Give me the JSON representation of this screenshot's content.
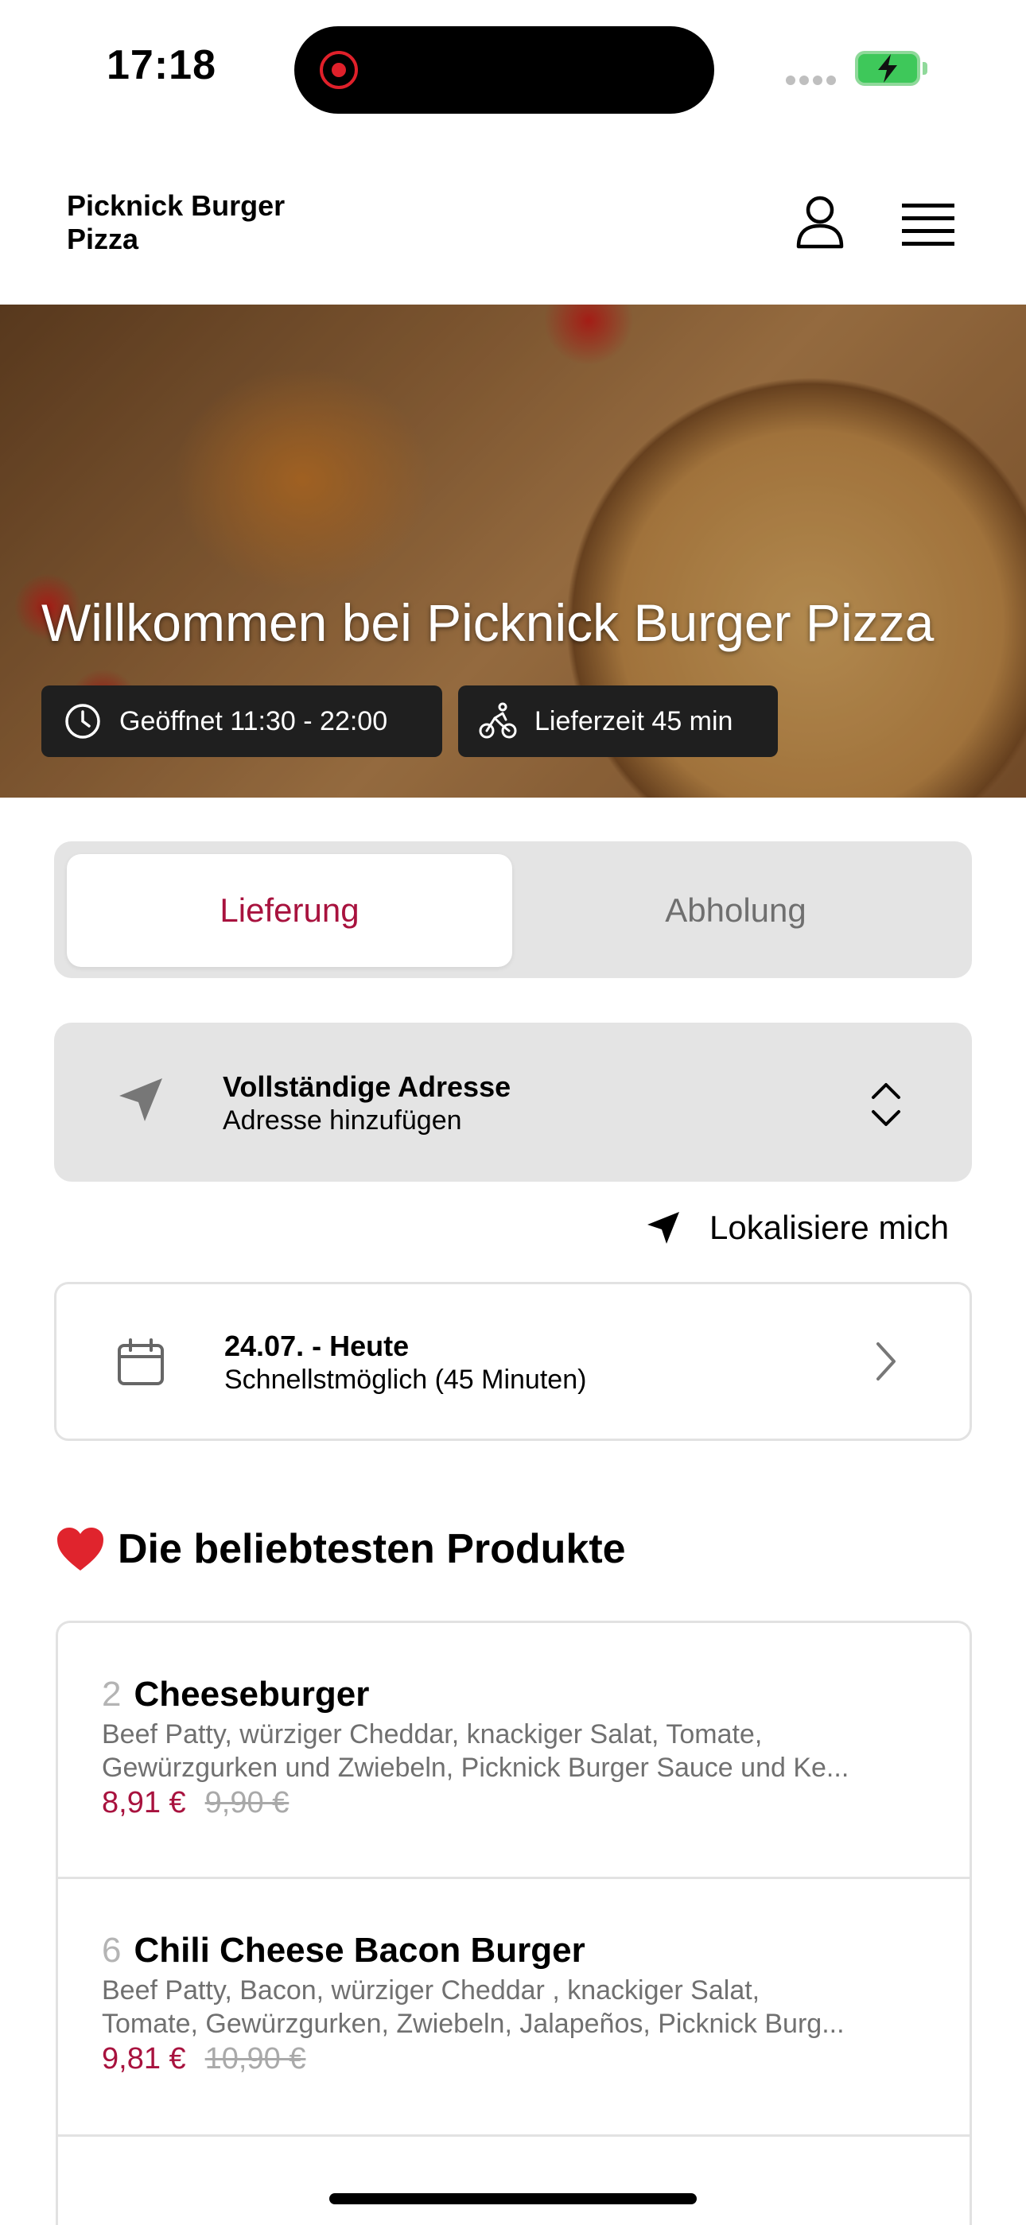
{
  "status_bar": {
    "time": "17:18"
  },
  "header": {
    "brand_line1": "Picknick Burger",
    "brand_line2": "Pizza"
  },
  "hero": {
    "title": "Willkommen bei Picknick Burger Pizza",
    "opening_hours": "Geöffnet 11:30 - 22:00",
    "delivery_time": "Lieferzeit 45 min"
  },
  "mode_tabs": {
    "active": "Lieferung",
    "inactive": "Abholung"
  },
  "address": {
    "title": "Vollständige Adresse",
    "subtitle": "Adresse hinzufügen"
  },
  "locate": {
    "label": "Lokalisiere mich"
  },
  "date": {
    "title": "24.07. - Heute",
    "subtitle": "Schnellstmöglich (45 Minuten)"
  },
  "section": {
    "emoji": "❤️",
    "title": "Die beliebtesten Produkte"
  },
  "products": [
    {
      "number": "2",
      "name": "Cheeseburger",
      "desc_line1": "Beef Patty, würziger Cheddar, knackiger Salat, Tomate,",
      "desc_line2": "Gewürzgurken und Zwiebeln, Picknick Burger Sauce und Ke...",
      "price": "8,91 €",
      "old_price": "9,90 €"
    },
    {
      "number": "6",
      "name": "Chili Cheese Bacon Burger",
      "desc_line1": "Beef Patty, Bacon, würziger Cheddar , knackiger Salat,",
      "desc_line2": "Tomate, Gewürzgurken, Zwiebeln, Jalapeños, Picknick Burg...",
      "price": "9,81 €",
      "old_price": "10,90 €"
    }
  ],
  "colors": {
    "accent": "#a8123e",
    "panel": "#e4e4e4",
    "chip": "#1f1f1f"
  },
  "icons": [
    "user-icon",
    "menu-icon",
    "clock-icon",
    "bicycle-icon",
    "location-arrow-icon",
    "chevron-updown-icon",
    "calendar-icon",
    "chevron-right-icon",
    "heart-icon"
  ]
}
